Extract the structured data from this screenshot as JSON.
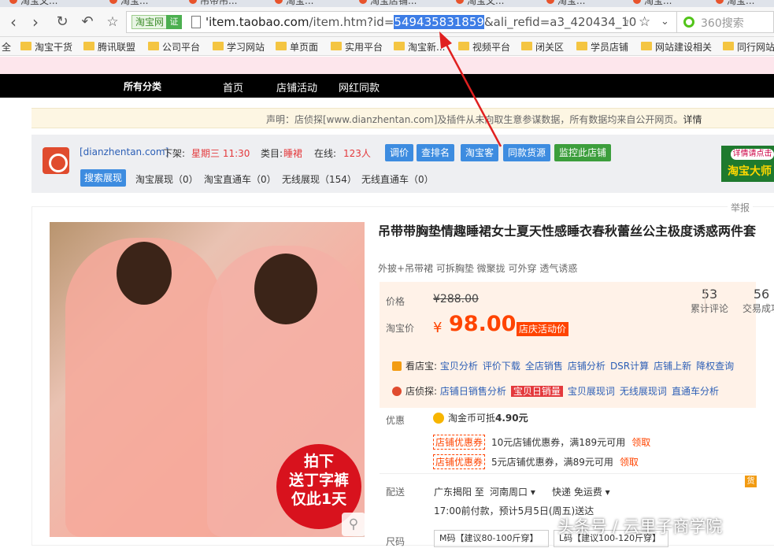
{
  "browser": {
    "tabs": [
      "淘宝文...",
      "淘宝...",
      "吊带吊...",
      "淘宝...",
      "淘宝店铺...",
      "淘宝文...",
      "淘宝...",
      "淘宝...",
      "淘宝..."
    ],
    "url_badge": "淘宝网",
    "url_verify": "证",
    "url_prefix": "'item.taobao.com/item.htm?id=",
    "url_domain": "'item.taobao.com",
    "url_path": "/item.htm?id=",
    "url_selected": "549435831859",
    "url_suffix": "&ali_refid=a3_420434_10",
    "search_placeholder": "360搜索",
    "bookmarks": [
      "全",
      "淘宝干货",
      "腾讯联盟",
      "公司平台",
      "学习网站",
      "单页面",
      "实用平台",
      "淘宝新...",
      "视频平台",
      "闭关区",
      "学员店铺",
      "网站建设相关",
      "同行网站"
    ]
  },
  "store_nav": {
    "items": [
      "所有分类",
      "首页",
      "店铺活动",
      "网红同款"
    ]
  },
  "notice": {
    "text": "声明：店侦探[www.dianzhentan.com]及插件从未向取生意参谋数据，所有数据均来自公开网页。",
    "detail": "详情"
  },
  "plugin": {
    "site": "[dianzhentan.com]",
    "offline_label": "下架:",
    "offline_value": "星期三 11:30",
    "category_label": "类目:",
    "category_value": "睡裙",
    "online_label": "在线:",
    "online_value": "123人",
    "buttons": [
      "调价",
      "查排名",
      "淘宝客",
      "同款货源",
      "监控此店铺"
    ],
    "search_show": "搜索展现",
    "stats": [
      "淘宝展现（0）",
      "淘宝直通车（0）",
      "无线展现（154）",
      "无线直通车（0）"
    ],
    "ad_top": "详情请点击",
    "ad_main": "淘宝大师"
  },
  "product": {
    "report": "举报",
    "title": "吊带带胸垫情趣睡裙女士夏天性感睡衣春秋蕾丝公主极度诱惑两件套",
    "subtitle": "外披+吊带裙 可拆胸垫 微聚拢 可外穿 透气诱惑",
    "promo_lines": [
      "拍下",
      "送丁字裤",
      "仅此1天"
    ],
    "price_label": "价格",
    "original_price": "¥288.00",
    "tb_price_label": "淘宝价",
    "currency": "¥",
    "price": "98.00",
    "price_tag": "店庆活动价",
    "reviews_count": "53",
    "reviews_label": "累计评论",
    "sales_count": "56",
    "sales_label": "交易成功",
    "kdz_label": "看店宝:",
    "kdz_links": [
      "宝贝分析",
      "评价下载",
      "全店销售",
      "店铺分析",
      "DSR计算",
      "店铺上新",
      "降权查询"
    ],
    "dzt_label": "店侦探:",
    "dzt_links": [
      "店铺日销售分析",
      "宝贝日销量",
      "宝贝展现词",
      "无线展现词",
      "直通车分析"
    ],
    "offers_label": "优惠",
    "coin_text": "淘金币可抵",
    "coin_value": "4.90元",
    "coupons": [
      {
        "tag": "店铺优惠券",
        "text": "10元店铺优惠券，满189元可用",
        "get": "领取"
      },
      {
        "tag": "店铺优惠券",
        "text": "5元店铺优惠券，满89元可用",
        "get": "领取"
      }
    ],
    "ship_label": "配送",
    "ship_from": "广东揭阳 至",
    "ship_to": "河南周口",
    "ship_method": "快递 免运费",
    "ship_note": "17:00前付款，预计5月5日(周五)送达",
    "huo": "货",
    "size_label": "尺码",
    "sizes": [
      "M码【建议80-100斤穿】",
      "L码【建议100-120斤穿】"
    ]
  },
  "watermark": "头条号 / 云里子商学院"
}
